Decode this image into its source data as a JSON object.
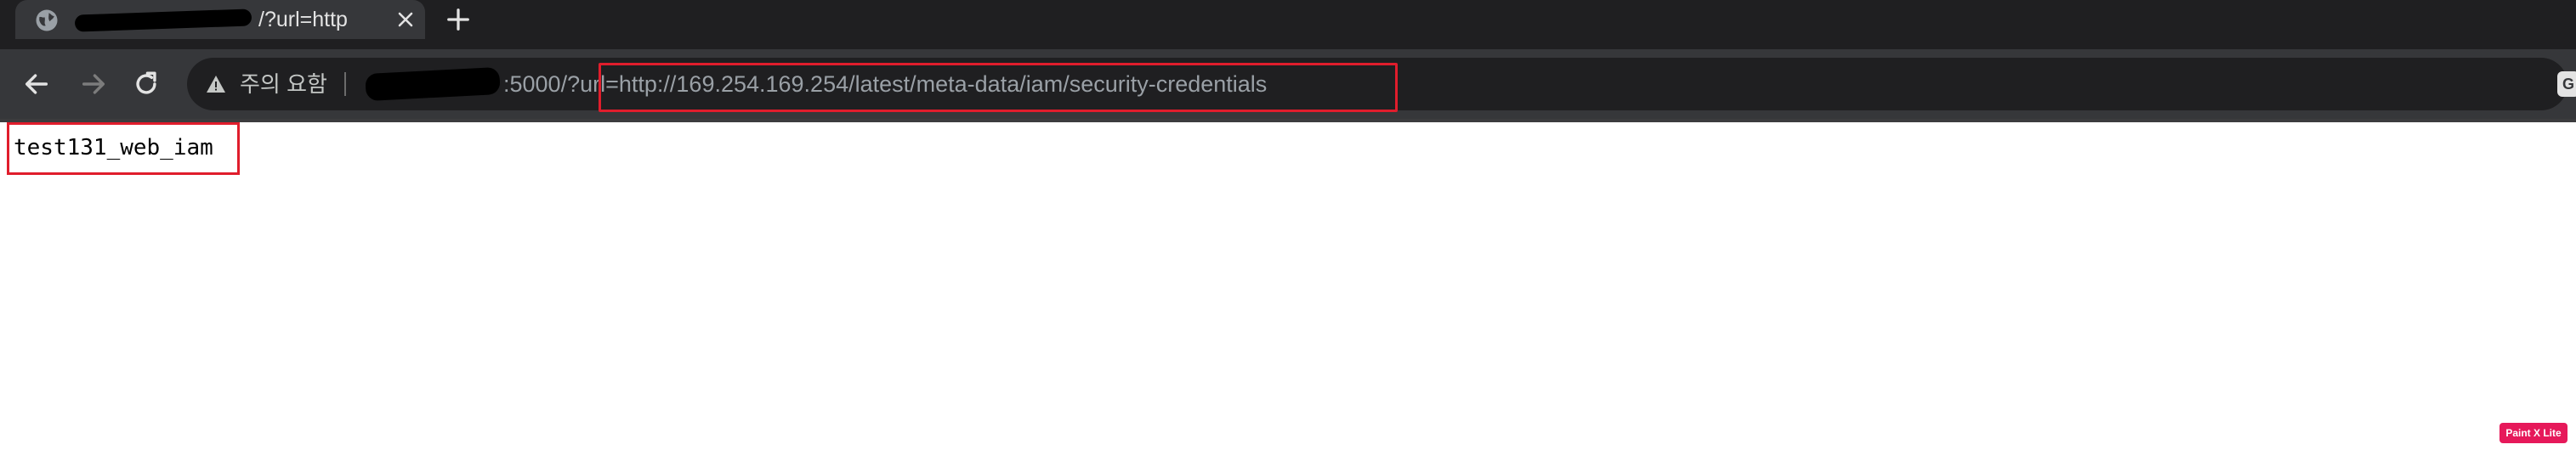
{
  "tab": {
    "title_suffix": "/?url=http",
    "close_icon": "close-icon",
    "favicon": "globe-icon"
  },
  "toolbar": {
    "back_icon": "arrow-left-icon",
    "forward_icon": "arrow-right-icon",
    "reload_icon": "reload-icon",
    "new_tab_icon": "plus-icon"
  },
  "omnibox": {
    "security_label": "주의 요함",
    "url_prefix": ":5000/?",
    "url_query": "url=http://169.254.169.254/latest/meta-data/iam/security-credentials",
    "warning_icon": "warning-triangle-icon"
  },
  "page": {
    "body_text": "test131_web_iam"
  },
  "watermark": {
    "label": "Paint X Lite"
  },
  "colors": {
    "tabstrip_bg": "#1f1f21",
    "toolbar_bg": "#36373a",
    "highlight": "#e01d2c",
    "watermark_bg": "#e6195a"
  }
}
